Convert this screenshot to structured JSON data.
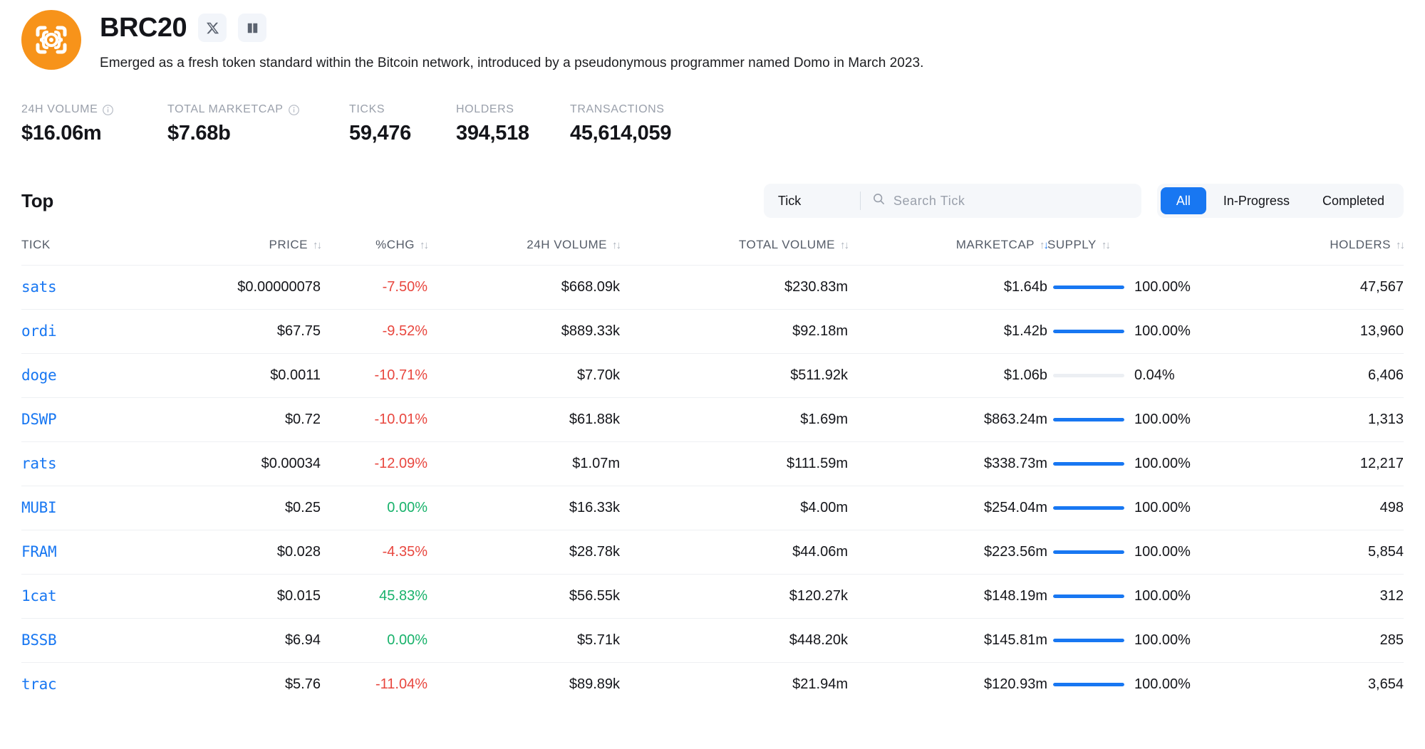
{
  "header": {
    "title": "BRC20",
    "description": "Emerged as a fresh token standard within the Bitcoin network, introduced by a pseudonymous programmer named Domo in March 2023.",
    "logo_icon": "brc20-bracket-target-icon",
    "logo_color": "#f7931a",
    "links": [
      {
        "name": "twitter-x-link",
        "icon": "x-icon"
      },
      {
        "name": "docs-link",
        "icon": "book-icon"
      }
    ]
  },
  "stats": [
    {
      "label": "24H VOLUME",
      "value": "$16.06m",
      "has_info": true
    },
    {
      "label": "TOTAL MARKETCAP",
      "value": "$7.68b",
      "has_info": true
    },
    {
      "label": "TICKS",
      "value": "59,476",
      "has_info": false
    },
    {
      "label": "HOLDERS",
      "value": "394,518",
      "has_info": false
    },
    {
      "label": "TRANSACTIONS",
      "value": "45,614,059",
      "has_info": false
    }
  ],
  "toolbar": {
    "section_title": "Top",
    "search_kind": "Tick",
    "search_value": "",
    "search_placeholder": "Search Tick",
    "search_icon": "search-icon",
    "filters": [
      {
        "label": "All",
        "active": true
      },
      {
        "label": "In-Progress",
        "active": false
      },
      {
        "label": "Completed",
        "active": false
      }
    ],
    "accent_color": "#1877f2"
  },
  "table": {
    "columns": [
      {
        "label": "TICK",
        "sortable": false,
        "align": "left"
      },
      {
        "label": "PRICE",
        "sortable": true,
        "align": "right"
      },
      {
        "label": "%CHG",
        "sortable": true,
        "align": "right"
      },
      {
        "label": "24H VOLUME",
        "sortable": true,
        "align": "right"
      },
      {
        "label": "TOTAL VOLUME",
        "sortable": true,
        "align": "right"
      },
      {
        "label": "MARKETCAP",
        "sortable": true,
        "align": "right",
        "sort_state": "desc"
      },
      {
        "label": "SUPPLY",
        "sortable": true,
        "align": "left"
      },
      {
        "label": "HOLDERS",
        "sortable": true,
        "align": "right"
      }
    ],
    "rows": [
      {
        "tick": "sats",
        "price": "$0.00000078",
        "chg": "-7.50%",
        "chg_dir": "neg",
        "vol24": "$668.09k",
        "total_volume": "$230.83m",
        "marketcap": "$1.64b",
        "supply_pct": "100.00%",
        "supply_value": 100,
        "holders": "47,567"
      },
      {
        "tick": "ordi",
        "price": "$67.75",
        "chg": "-9.52%",
        "chg_dir": "neg",
        "vol24": "$889.33k",
        "total_volume": "$92.18m",
        "marketcap": "$1.42b",
        "supply_pct": "100.00%",
        "supply_value": 100,
        "holders": "13,960"
      },
      {
        "tick": "doge",
        "price": "$0.0011",
        "chg": "-10.71%",
        "chg_dir": "neg",
        "vol24": "$7.70k",
        "total_volume": "$511.92k",
        "marketcap": "$1.06b",
        "supply_pct": "0.04%",
        "supply_value": 0.04,
        "holders": "6,406"
      },
      {
        "tick": "DSWP",
        "price": "$0.72",
        "chg": "-10.01%",
        "chg_dir": "neg",
        "vol24": "$61.88k",
        "total_volume": "$1.69m",
        "marketcap": "$863.24m",
        "supply_pct": "100.00%",
        "supply_value": 100,
        "holders": "1,313"
      },
      {
        "tick": "rats",
        "price": "$0.00034",
        "chg": "-12.09%",
        "chg_dir": "neg",
        "vol24": "$1.07m",
        "total_volume": "$111.59m",
        "marketcap": "$338.73m",
        "supply_pct": "100.00%",
        "supply_value": 100,
        "holders": "12,217"
      },
      {
        "tick": "MUBI",
        "price": "$0.25",
        "chg": "0.00%",
        "chg_dir": "pos",
        "vol24": "$16.33k",
        "total_volume": "$4.00m",
        "marketcap": "$254.04m",
        "supply_pct": "100.00%",
        "supply_value": 100,
        "holders": "498"
      },
      {
        "tick": "FRAM",
        "price": "$0.028",
        "chg": "-4.35%",
        "chg_dir": "neg",
        "vol24": "$28.78k",
        "total_volume": "$44.06m",
        "marketcap": "$223.56m",
        "supply_pct": "100.00%",
        "supply_value": 100,
        "holders": "5,854"
      },
      {
        "tick": "1cat",
        "price": "$0.015",
        "chg": "45.83%",
        "chg_dir": "pos",
        "vol24": "$56.55k",
        "total_volume": "$120.27k",
        "marketcap": "$148.19m",
        "supply_pct": "100.00%",
        "supply_value": 100,
        "holders": "312"
      },
      {
        "tick": "BSSB",
        "price": "$6.94",
        "chg": "0.00%",
        "chg_dir": "pos",
        "vol24": "$5.71k",
        "total_volume": "$448.20k",
        "marketcap": "$145.81m",
        "supply_pct": "100.00%",
        "supply_value": 100,
        "holders": "285"
      },
      {
        "tick": "trac",
        "price": "$5.76",
        "chg": "-11.04%",
        "chg_dir": "neg",
        "vol24": "$89.89k",
        "total_volume": "$21.94m",
        "marketcap": "$120.93m",
        "supply_pct": "100.00%",
        "supply_value": 100,
        "holders": "3,654"
      }
    ]
  }
}
